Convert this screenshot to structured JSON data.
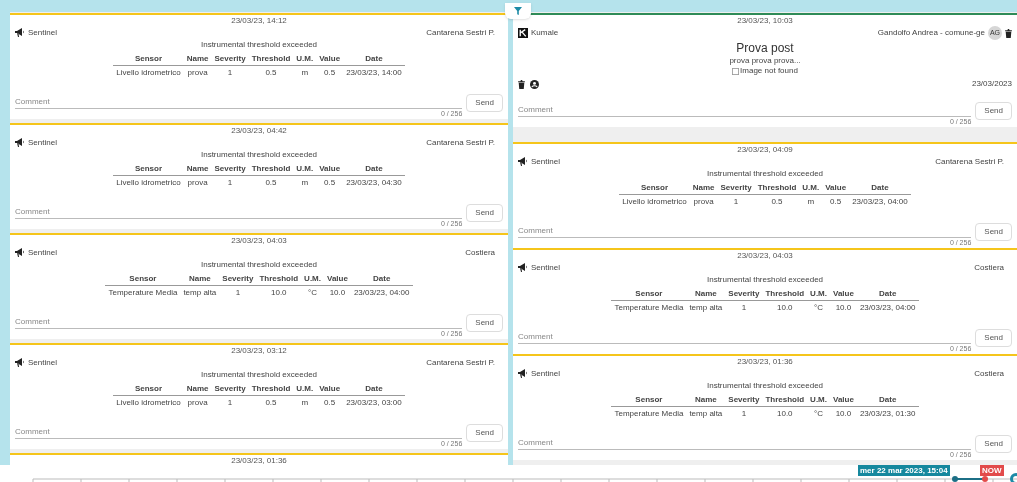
{
  "columns": [
    {
      "cards": [
        {
          "kind": "alert",
          "date": "23/03/23, 14:12",
          "source": "Sentinel",
          "location": "Cantarena Sestri P.",
          "title": "Instrumental threshold exceeded",
          "table": {
            "columns": [
              "Sensor",
              "Name",
              "Severity",
              "Threshold",
              "U.M.",
              "Value",
              "Date"
            ],
            "rows": [
              [
                "Livello idrometrico",
                "prova",
                "1",
                "0.5",
                "m",
                "0.5",
                "23/03/23, 14:00"
              ]
            ]
          },
          "comment": {
            "placeholder": "Comment",
            "counter": "0 / 256"
          },
          "send": "Send"
        },
        {
          "kind": "alert",
          "date": "23/03/23, 04:42",
          "source": "Sentinel",
          "location": "Cantarena Sestri P.",
          "title": "Instrumental threshold exceeded",
          "table": {
            "columns": [
              "Sensor",
              "Name",
              "Severity",
              "Threshold",
              "U.M.",
              "Value",
              "Date"
            ],
            "rows": [
              [
                "Livello idrometrico",
                "prova",
                "1",
                "0.5",
                "m",
                "0.5",
                "23/03/23, 04:30"
              ]
            ]
          },
          "comment": {
            "placeholder": "Comment",
            "counter": "0 / 256"
          },
          "send": "Send"
        },
        {
          "kind": "alert",
          "date": "23/03/23, 04:03",
          "source": "Sentinel",
          "location": "Costiera",
          "title": "Instrumental threshold exceeded",
          "table": {
            "columns": [
              "Sensor",
              "Name",
              "Severity",
              "Threshold",
              "U.M.",
              "Value",
              "Date"
            ],
            "rows": [
              [
                "Temperature Media",
                "temp alta",
                "1",
                "10.0",
                "°C",
                "10.0",
                "23/03/23, 04:00"
              ]
            ]
          },
          "comment": {
            "placeholder": "Comment",
            "counter": "0 / 256"
          },
          "send": "Send"
        },
        {
          "kind": "alert",
          "date": "23/03/23, 03:12",
          "source": "Sentinel",
          "location": "Cantarena Sestri P.",
          "title": "Instrumental threshold exceeded",
          "table": {
            "columns": [
              "Sensor",
              "Name",
              "Severity",
              "Threshold",
              "U.M.",
              "Value",
              "Date"
            ],
            "rows": [
              [
                "Livello idrometrico",
                "prova",
                "1",
                "0.5",
                "m",
                "0.5",
                "23/03/23, 03:00"
              ]
            ]
          },
          "comment": {
            "placeholder": "Comment",
            "counter": "0 / 256"
          },
          "send": "Send"
        },
        {
          "kind": "partial",
          "date": "23/03/23, 01:36"
        }
      ]
    },
    {
      "cards": [
        {
          "kind": "post",
          "date": "23/03/23, 10:03",
          "source": "Kumale",
          "author": "Gandolfo Andrea - comune-ge",
          "avatar": "AG",
          "title": "Prova post",
          "body": "prova prova prova...",
          "image_alt": "Image not found",
          "post_date": "23/03/2023",
          "comment": {
            "placeholder": "Comment",
            "counter": "0 / 256"
          },
          "send": "Send"
        },
        {
          "kind": "alert",
          "date": "23/03/23, 04:09",
          "source": "Sentinel",
          "location": "Cantarena Sestri P.",
          "title": "Instrumental threshold exceeded",
          "table": {
            "columns": [
              "Sensor",
              "Name",
              "Severity",
              "Threshold",
              "U.M.",
              "Value",
              "Date"
            ],
            "rows": [
              [
                "Livello idrometrico",
                "prova",
                "1",
                "0.5",
                "m",
                "0.5",
                "23/03/23, 04:00"
              ]
            ]
          },
          "comment": {
            "placeholder": "Comment",
            "counter": "0 / 256"
          },
          "send": "Send"
        },
        {
          "kind": "alert",
          "date": "23/03/23, 04:03",
          "source": "Sentinel",
          "location": "Costiera",
          "title": "Instrumental threshold exceeded",
          "table": {
            "columns": [
              "Sensor",
              "Name",
              "Severity",
              "Threshold",
              "U.M.",
              "Value",
              "Date"
            ],
            "rows": [
              [
                "Temperature Media",
                "temp alta",
                "1",
                "10.0",
                "°C",
                "10.0",
                "23/03/23, 04:00"
              ]
            ]
          },
          "comment": {
            "placeholder": "Comment",
            "counter": "0 / 256"
          },
          "send": "Send"
        },
        {
          "kind": "alert",
          "date": "23/03/23, 01:36",
          "source": "Sentinel",
          "location": "Costiera",
          "title": "Instrumental threshold exceeded",
          "table": {
            "columns": [
              "Sensor",
              "Name",
              "Severity",
              "Threshold",
              "U.M.",
              "Value",
              "Date"
            ],
            "rows": [
              [
                "Temperature Media",
                "temp alta",
                "1",
                "10.0",
                "°C",
                "10.0",
                "23/03/23, 01:30"
              ]
            ]
          },
          "comment": {
            "placeholder": "Comment",
            "counter": "0 / 256"
          },
          "send": "Send"
        }
      ]
    }
  ],
  "timeline": {
    "cursor_label": "mer 22 mar 2023, 15:04",
    "now_label": "NOW"
  }
}
